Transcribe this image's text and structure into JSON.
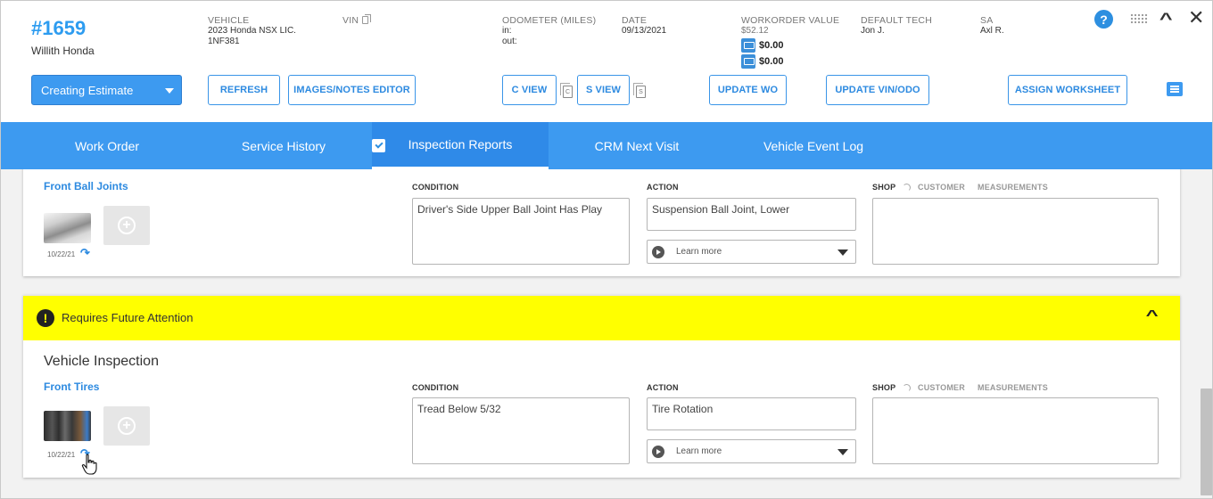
{
  "header": {
    "wo_number": "#1659",
    "customer": "Willith Honda",
    "vehicle": {
      "label": "VEHICLE",
      "line1": "2023 Honda NSX LIC.",
      "line2": "1NF381"
    },
    "vin": {
      "label": "VIN"
    },
    "odometer": {
      "label": "ODOMETER (MILES)",
      "in": "in:",
      "out": "out:"
    },
    "date": {
      "label": "DATE",
      "value": "09/13/2021"
    },
    "workorder_value": {
      "label": "WORKORDER VALUE",
      "value": "$52.12",
      "amount1": "$0.00",
      "amount2": "$0.00"
    },
    "default_tech": {
      "label": "DEFAULT TECH",
      "value": "Jon J."
    },
    "sa": {
      "label": "SA",
      "value": "Axl R."
    }
  },
  "toolbar": {
    "status": "Creating Estimate",
    "refresh": "REFRESH",
    "images_notes": "IMAGES/NOTES EDITOR",
    "c_view": "C VIEW",
    "c_doc": "C",
    "s_view": "S VIEW",
    "s_doc": "S",
    "update_wo": "UPDATE WO",
    "update_vin": "UPDATE VIN/ODO",
    "assign_worksheet": "ASSIGN WORKSHEET"
  },
  "tabs": [
    {
      "label": "Work Order"
    },
    {
      "label": "Service History"
    },
    {
      "label": "Inspection Reports"
    },
    {
      "label": "CRM Next Visit"
    },
    {
      "label": "Vehicle Event Log"
    }
  ],
  "items": [
    {
      "title": "Front Ball Joints",
      "image_date": "10/22/21",
      "condition_label": "CONDITION",
      "condition": "Driver's Side Upper Ball Joint Has Play",
      "action_label": "ACTION",
      "action": "Suspension Ball Joint, Lower",
      "learn_more": "Learn more",
      "shop": "SHOP",
      "customer": "CUSTOMER",
      "measurements": "MEASUREMENTS"
    },
    {
      "title": "Front Tires",
      "image_date": "10/22/21",
      "condition_label": "CONDITION",
      "condition": "Tread Below 5/32",
      "action_label": "ACTION",
      "action": "Tire Rotation",
      "learn_more": "Learn more",
      "shop": "SHOP",
      "customer": "CUSTOMER",
      "measurements": "MEASUREMENTS"
    }
  ],
  "alert": {
    "text": "Requires Future Attention",
    "icon": "!"
  },
  "section_title": "Vehicle Inspection",
  "icons": {
    "help": "?",
    "add": "+"
  },
  "colors": {
    "accent": "#3d9af0",
    "alert": "#ffff00"
  }
}
